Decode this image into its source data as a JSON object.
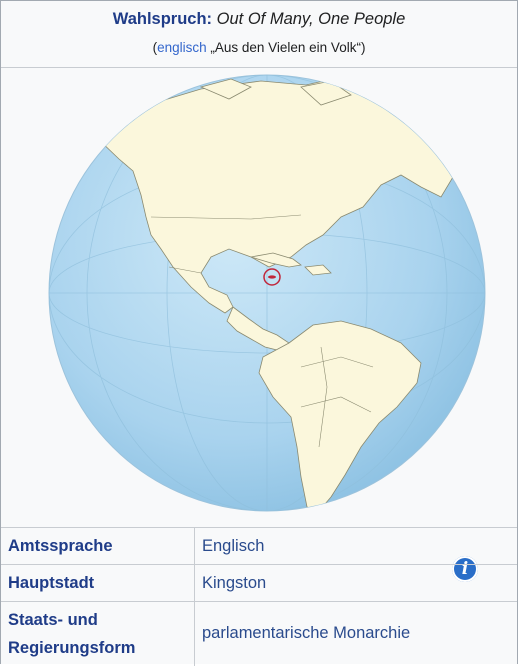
{
  "motto": {
    "label": "Wahlspruch:",
    "text": "Out Of Many, One People",
    "trans_open": "(",
    "trans_link": "englisch",
    "trans_quote": " „Aus den Vielen ein Volk“)"
  },
  "map": {
    "icon": "info-icon",
    "icon_glyph": "i",
    "ocean_color": "#aed6f1",
    "land_color": "#fbf7dc",
    "highlight_color": "#c0263b"
  },
  "rows": [
    {
      "key": "Amtssprache",
      "value": "Englisch"
    },
    {
      "key": "Hauptstadt",
      "value": "Kingston"
    },
    {
      "key_line1": "Staats- und",
      "key_line2": "Regierungsform",
      "value": "parlamentarische Monarchie"
    }
  ]
}
